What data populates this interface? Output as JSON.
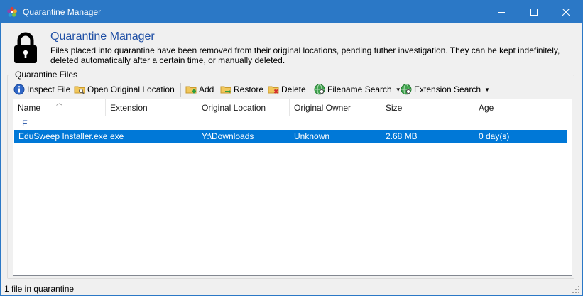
{
  "window": {
    "title": "Quarantine Manager",
    "minimize": "minimize",
    "maximize": "maximize",
    "close": "close",
    "accent": "#2b78c6"
  },
  "header": {
    "title": "Quarantine Manager",
    "description": "Files placed into quarantine have been removed from their original locations, pending futher investigation. They can be kept indefinitely, deleted automatically after a certain time, or manually deleted.",
    "icon": "lock-icon"
  },
  "group": {
    "label": "Quarantine Files"
  },
  "toolbar": {
    "inspect_file": "Inspect File",
    "open_original_location": "Open Original Location",
    "add": "Add",
    "restore": "Restore",
    "delete": "Delete",
    "filename_search": "Filename Search",
    "extension_search": "Extension Search"
  },
  "list": {
    "columns": [
      "Name",
      "Extension",
      "Original Location",
      "Original Owner",
      "Size",
      "Age"
    ],
    "group_header": "E",
    "rows": [
      {
        "name": "EduSweep Installer.exe",
        "extension": "exe",
        "original_location": "Y:\\Downloads",
        "original_owner": "Unknown",
        "size": "2.68 MB",
        "age": "0 day(s)"
      }
    ],
    "selection_color": "#0078d7"
  },
  "status": {
    "text": "1 file in quarantine"
  }
}
